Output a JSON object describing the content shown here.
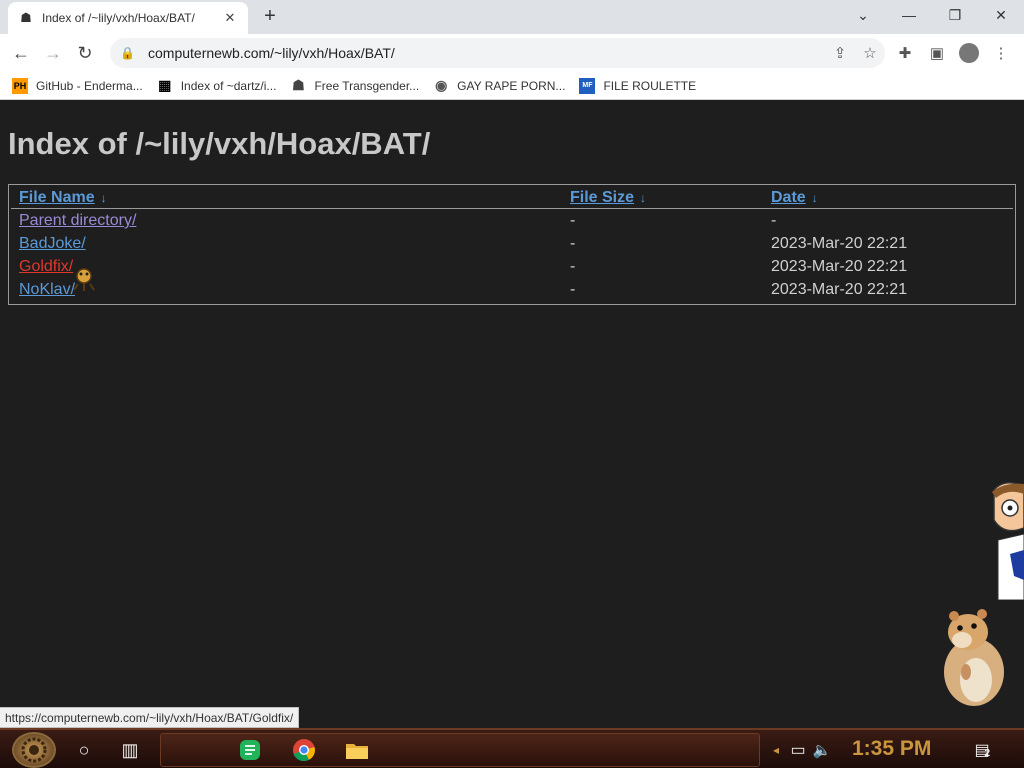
{
  "browser": {
    "tab_title": "Index of /~lily/vxh/Hoax/BAT/",
    "tab_close": "✕",
    "new_tab": "+",
    "url": "computernewb.com/~lily/vxh/Hoax/BAT/",
    "window": {
      "minimize": "—",
      "maximize": "❐",
      "close": "✕",
      "tabsearch": "⌄"
    }
  },
  "bookmarks": [
    {
      "label": "GitHub - Enderma...",
      "icon": "PH",
      "icon_name": "pornhub-favicon"
    },
    {
      "label": "Index of ~dartz/i...",
      "icon": "▦",
      "icon_name": "qr-favicon"
    },
    {
      "label": "Free Transgender...",
      "icon": "☗",
      "icon_name": "trollface-favicon"
    },
    {
      "label": "GAY RAPE PORN...",
      "icon": "◉",
      "icon_name": "globe-favicon"
    },
    {
      "label": "FILE ROULETTE",
      "icon": "MF",
      "icon_name": "mediafire-favicon"
    }
  ],
  "page": {
    "heading": "Index of /~lily/vxh/Hoax/BAT/",
    "columns": [
      {
        "label": "File Name",
        "arrow": "↓"
      },
      {
        "label": "File Size",
        "arrow": "↓"
      },
      {
        "label": "Date",
        "arrow": "↓"
      }
    ],
    "rows": [
      {
        "name": "Parent directory/",
        "size": "-",
        "date": "-",
        "state": "visited"
      },
      {
        "name": "BadJoke/",
        "size": "-",
        "date": "2023-Mar-20 22:21",
        "state": "normal"
      },
      {
        "name": "Goldfix/",
        "size": "-",
        "date": "2023-Mar-20 22:21",
        "state": "hover"
      },
      {
        "name": "NoKlav/",
        "size": "-",
        "date": "2023-Mar-20 22:21",
        "state": "normal"
      }
    ]
  },
  "status_url": "https://computernewb.com/~lily/vxh/Hoax/BAT/Goldfix/",
  "taskbar": {
    "clock": "1:35 PM",
    "notification_count": "2"
  },
  "colors": {
    "page_bg": "#1e1e1e",
    "link": "#5b9ad8",
    "visited": "#9a8ad6",
    "hover": "#e0372b",
    "clock": "#c9963f"
  }
}
